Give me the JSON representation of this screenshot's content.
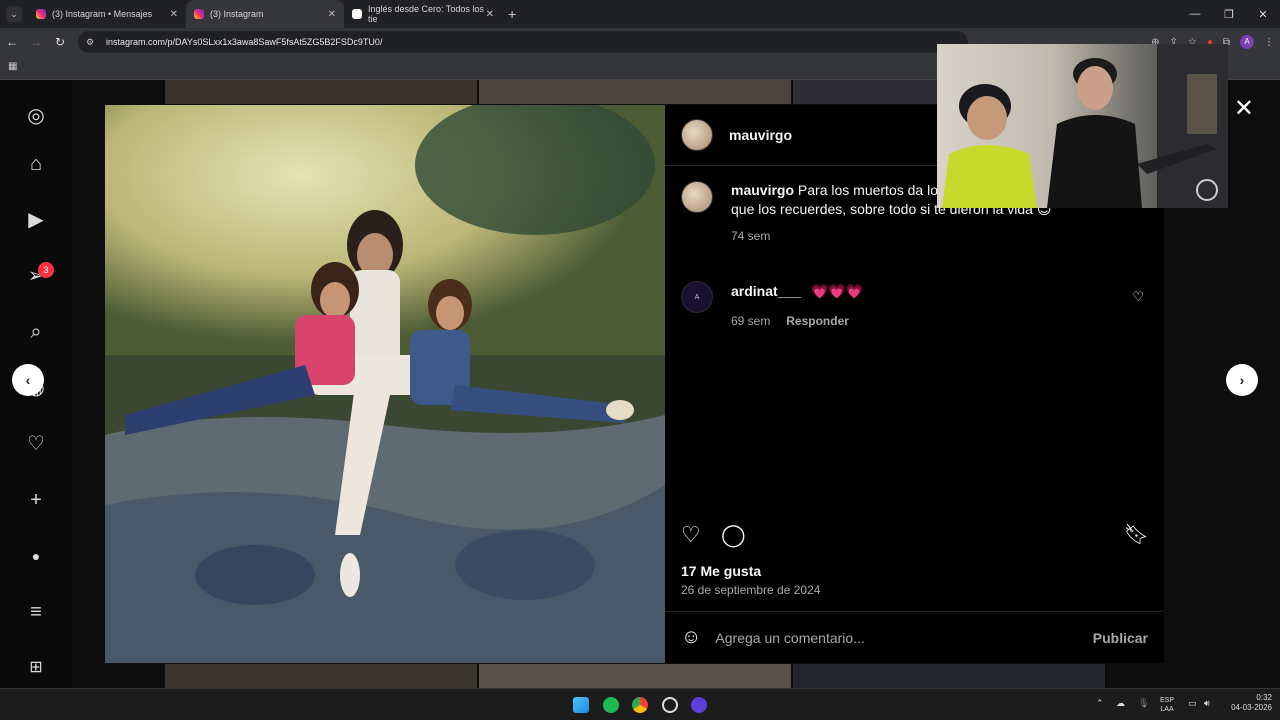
{
  "browser": {
    "tabs": [
      {
        "title": "(3) Instagram • Mensajes",
        "active": false
      },
      {
        "title": "(3) Instagram",
        "active": true
      },
      {
        "title": "Inglés desde Cero: Todos los tie",
        "active": false
      }
    ],
    "url": "instagram.com/p/DAYs0SLxx1x3awa8SawF5fsAt5ZG5B2FSDc9TU0/",
    "profile_initial": "A"
  },
  "sidebar": {
    "notification_count": "3"
  },
  "post": {
    "author": "mauvirgo",
    "caption_user": "mauvirgo",
    "caption_text": "Para los muertos da lo",
    "caption_text_cont": "años, siempre te van a pedir que los recuerdes, sobre todo si te dieron la vida 😊",
    "caption_time": "74 sem",
    "comments": [
      {
        "user": "ardinat___",
        "text": "💗💗💗",
        "time": "69 sem",
        "reply": "Responder"
      }
    ],
    "likes": "17 Me gusta",
    "date": "26 de septiembre de 2024",
    "add_comment_placeholder": "Agrega un comentario...",
    "publish": "Publicar"
  },
  "taskbar": {
    "lang_top": "ESP",
    "lang_bottom": "LAA",
    "time": "0:32",
    "date": "04-03-2026"
  },
  "colors": {
    "accent_like": "#ff3040",
    "panel_bg": "#000000"
  }
}
